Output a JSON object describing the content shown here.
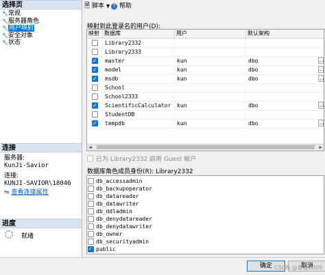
{
  "left_pane": {
    "select_page_header": "选择页",
    "pages": [
      {
        "label": "常规",
        "icon": "wrench-icon",
        "selected": false
      },
      {
        "label": "服务器角色",
        "icon": "wrench-icon",
        "selected": false
      },
      {
        "label": "用户映射",
        "icon": "wrench-icon",
        "selected": true
      },
      {
        "label": "安全对象",
        "icon": "wrench-icon",
        "selected": false
      },
      {
        "label": "状态",
        "icon": "wrench-icon",
        "selected": false
      }
    ],
    "connection_header": "连接",
    "server_label": "服务器:",
    "server_value": "KunJi-Savior",
    "connection_label": "连接:",
    "connection_value": "KUNJI-SAVIOR\\18046",
    "view_connection_props": "查看连接属性",
    "progress_header": "进度",
    "progress_status": "就绪"
  },
  "toolbar": {
    "script_label": "脚本",
    "help_label": "帮助"
  },
  "users_section": {
    "title": "映射到此登录名的用户(D):",
    "columns": [
      "映射",
      "数据库",
      "用户",
      "默认架构"
    ],
    "rows": [
      {
        "mapped": false,
        "database": "Library2332",
        "user": "",
        "schema": "",
        "ellipsis": false
      },
      {
        "mapped": false,
        "database": "Library2333",
        "user": "",
        "schema": "",
        "ellipsis": false
      },
      {
        "mapped": true,
        "database": "master",
        "user": "kun",
        "schema": "dbo",
        "ellipsis": true
      },
      {
        "mapped": true,
        "database": "model",
        "user": "kun",
        "schema": "dbo",
        "ellipsis": true
      },
      {
        "mapped": true,
        "database": "msdb",
        "user": "kun",
        "schema": "dbo",
        "ellipsis": true
      },
      {
        "mapped": false,
        "database": "School",
        "user": "",
        "schema": "",
        "ellipsis": false
      },
      {
        "mapped": false,
        "database": "School2333",
        "user": "",
        "schema": "",
        "ellipsis": false
      },
      {
        "mapped": true,
        "database": "ScientificCalculator",
        "user": "kun",
        "schema": "dbo",
        "ellipsis": true
      },
      {
        "mapped": false,
        "database": "StudentDB",
        "user": "",
        "schema": "",
        "ellipsis": false
      },
      {
        "mapped": true,
        "database": "tempdb",
        "user": "kun",
        "schema": "dbo",
        "ellipsis": true
      }
    ],
    "ellipsis_label": "..."
  },
  "guest": {
    "label": "已为 Library2332 启用 Guest 帐户",
    "checked": false
  },
  "roles_section": {
    "title": "数据库角色成员身份(R): Library2332",
    "roles": [
      {
        "name": "db_accessadmin",
        "checked": false
      },
      {
        "name": "db_backupoperator",
        "checked": false
      },
      {
        "name": "db_datareader",
        "checked": false
      },
      {
        "name": "db_datawriter",
        "checked": false
      },
      {
        "name": "db_ddladmin",
        "checked": false
      },
      {
        "name": "db_denydatareader",
        "checked": false
      },
      {
        "name": "db_denydatawriter",
        "checked": false
      },
      {
        "name": "db_owner",
        "checked": false
      },
      {
        "name": "db_securityadmin",
        "checked": false
      },
      {
        "name": "public",
        "checked": true
      }
    ]
  },
  "footer": {
    "ok_label": "确定",
    "cancel_label": "取消",
    "watermark": "CSDN @寄昔2009"
  },
  "colors": {
    "accent": "#0078d7",
    "checkbox_checked": "#1573d4",
    "section_header_bg": "#d9e4f1"
  }
}
